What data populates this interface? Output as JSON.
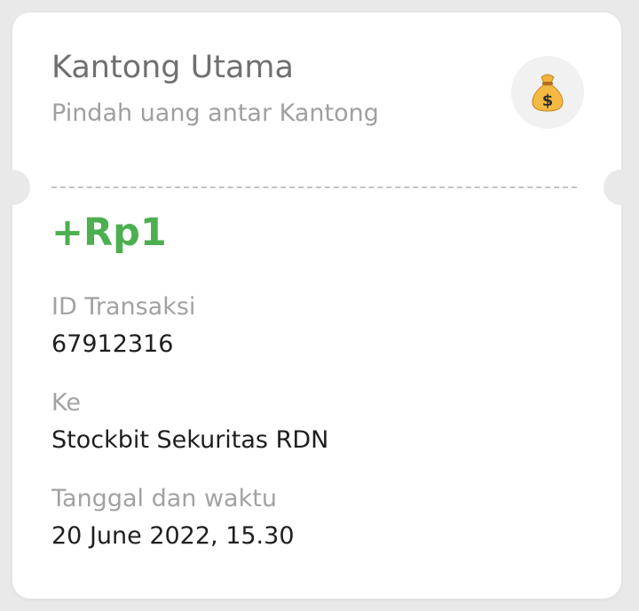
{
  "header": {
    "title": "Kantong Utama",
    "subtitle": "Pindah uang antar Kantong",
    "icon": "money-bag-icon"
  },
  "transaction": {
    "amount": "+Rp1",
    "amount_color": "#4caf50",
    "id_label": "ID Transaksi",
    "id_value": "67912316",
    "to_label": "Ke",
    "to_value": "Stockbit Sekuritas RDN",
    "datetime_label": "Tanggal dan waktu",
    "datetime_value": "20 June 2022, 15.30"
  }
}
